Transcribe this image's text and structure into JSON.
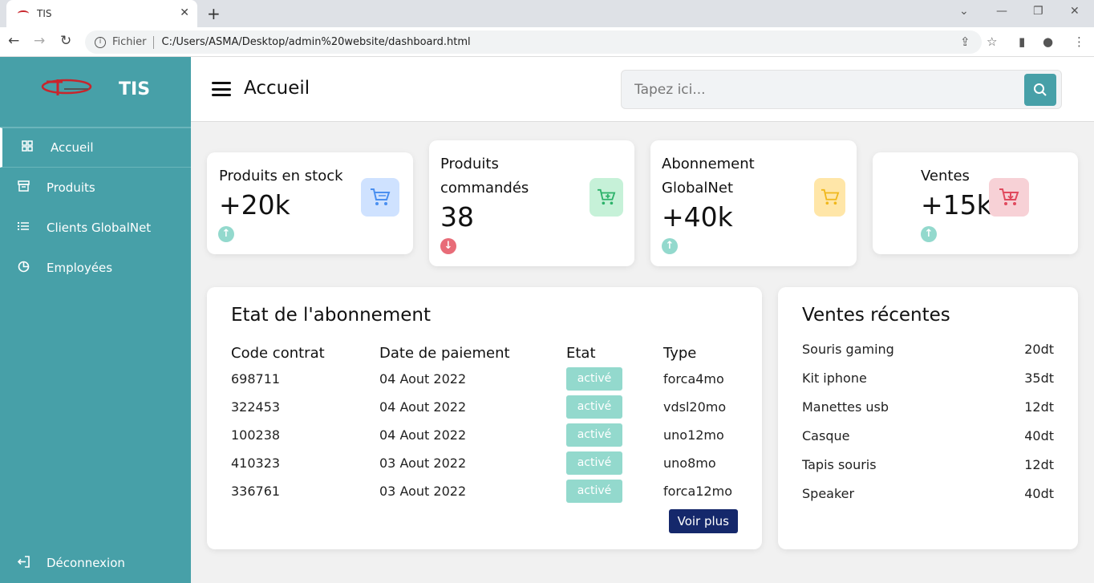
{
  "browser": {
    "tab_title": "TIS",
    "close_tab": "✕",
    "new_tab": "+",
    "fichier_label": "Fichier",
    "url": "C:/Users/ASMA/Desktop/admin%20website/dashboard.html"
  },
  "sidebar": {
    "brand": "TIS",
    "items": [
      {
        "label": "Accueil",
        "icon": "grid-icon"
      },
      {
        "label": "Produits",
        "icon": "archive-icon"
      },
      {
        "label": "Clients GlobalNet",
        "icon": "list-icon"
      },
      {
        "label": "Employées",
        "icon": "pie-chart-icon"
      }
    ],
    "logout": "Déconnexion"
  },
  "header": {
    "title": "Accueil",
    "search_placeholder": "Tapez ici..."
  },
  "cards": [
    {
      "label_l1": "Produits en stock",
      "label_l2": "",
      "value": "+20k",
      "trend": "up",
      "icon_bg": "#cfe2ff",
      "icon_color": "#4a8ff0"
    },
    {
      "label_l1": "Produits",
      "label_l2": "commandés",
      "value": "38",
      "trend": "down",
      "icon_bg": "#c6f1d8",
      "icon_color": "#2cb26a"
    },
    {
      "label_l1": "Abonnement",
      "label_l2": "GlobalNet",
      "value": "+40k",
      "trend": "up",
      "icon_bg": "#ffe6a8",
      "icon_color": "#f0b81c"
    },
    {
      "label_l1": "Ventes",
      "label_l2": "",
      "value": "+15k",
      "trend": "up",
      "icon_bg": "#f7d1d6",
      "icon_color": "#e04a5e"
    }
  ],
  "subscriptions": {
    "title": "Etat de l'abonnement",
    "columns": [
      "Code contrat",
      "Date de paiement",
      "Etat",
      "Type"
    ],
    "rows": [
      {
        "code": "698711",
        "date": "04 Aout 2022",
        "etat": "activé",
        "type": "forca4mo"
      },
      {
        "code": "322453",
        "date": "04 Aout 2022",
        "etat": "activé",
        "type": "vdsl20mo"
      },
      {
        "code": "100238",
        "date": "04 Aout 2022",
        "etat": "activé",
        "type": "uno12mo"
      },
      {
        "code": "410323",
        "date": "03 Aout 2022",
        "etat": "activé",
        "type": "uno8mo"
      },
      {
        "code": "336761",
        "date": "03 Aout 2022",
        "etat": "activé",
        "type": "forca12mo"
      }
    ],
    "more_button": "Voir plus"
  },
  "recent_sales": {
    "title": "Ventes récentes",
    "items": [
      {
        "name": "Souris gaming",
        "price": "20dt"
      },
      {
        "name": "Kit iphone",
        "price": "35dt"
      },
      {
        "name": "Manettes usb",
        "price": "12dt"
      },
      {
        "name": "Casque",
        "price": "40dt"
      },
      {
        "name": "Tapis souris",
        "price": "12dt"
      },
      {
        "name": "Speaker",
        "price": "40dt"
      }
    ]
  },
  "colors": {
    "accent": "#47a0a8",
    "trend_up": "#93d9cd",
    "trend_down": "#e86c78",
    "button": "#15286b"
  }
}
